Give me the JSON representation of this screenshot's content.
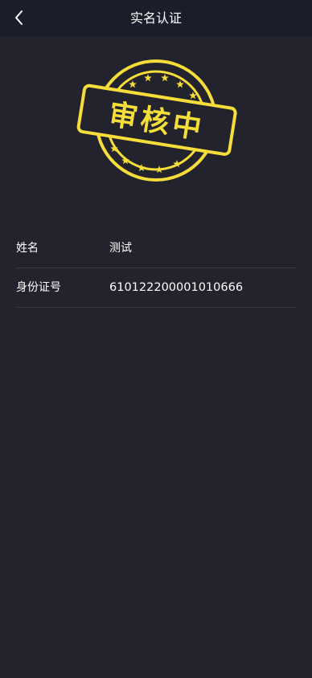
{
  "header": {
    "title": "实名认证",
    "back_icon": "chevron-left-icon"
  },
  "stamp": {
    "text": "审核中",
    "color": "#f5dd3a",
    "icon": "review-stamp-icon"
  },
  "info": {
    "rows": [
      {
        "label": "姓名",
        "value": "测试"
      },
      {
        "label": "身份证号",
        "value": "610122200001010666"
      }
    ]
  },
  "colors": {
    "background": "#22232c",
    "header": "#1a1e2b",
    "text": "#ffffff",
    "divider": "#3a3b45"
  }
}
